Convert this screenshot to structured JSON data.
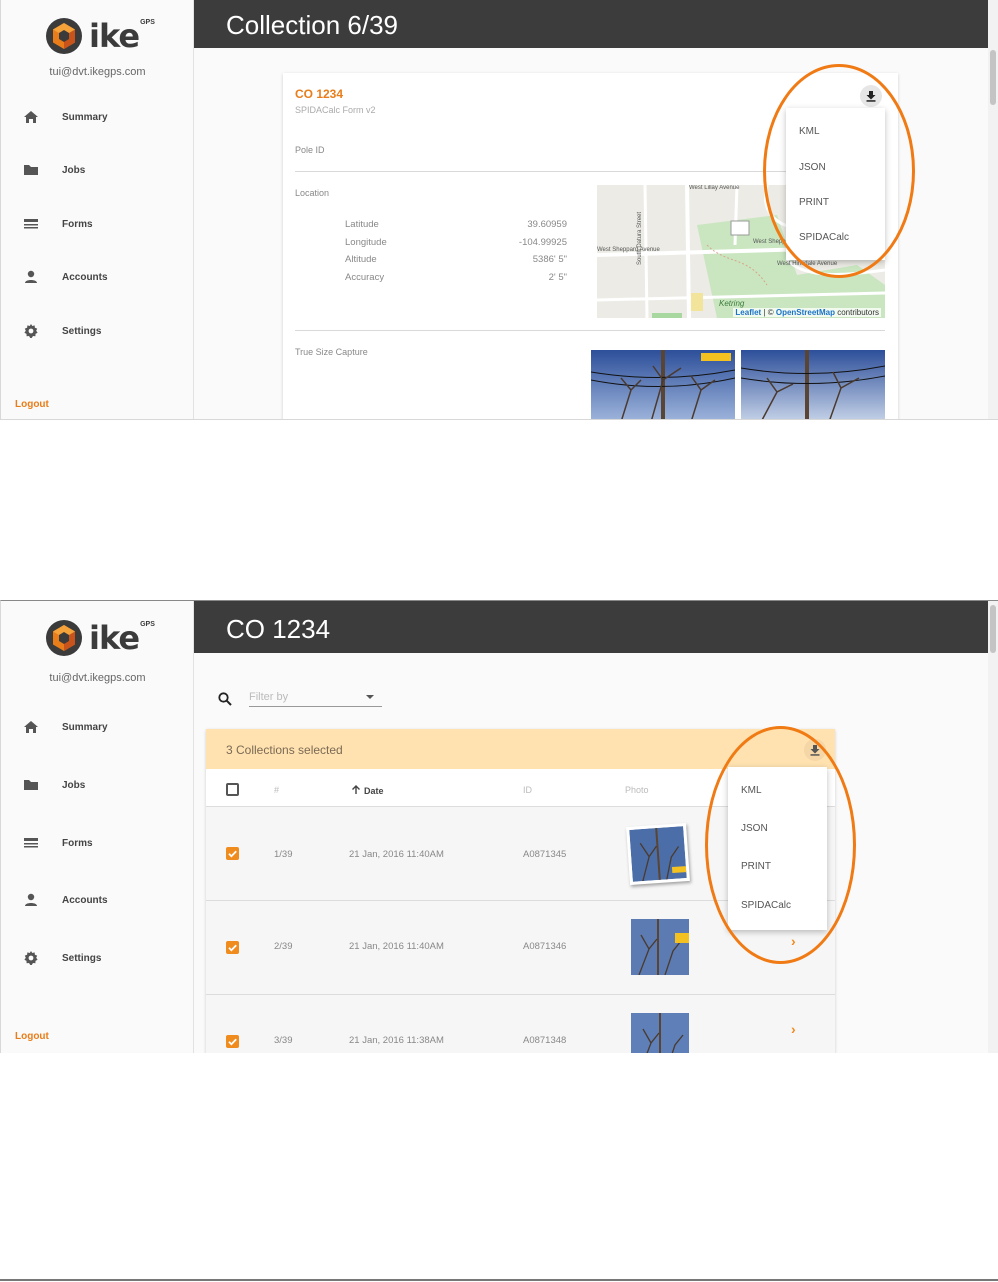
{
  "brand": {
    "name": "ike",
    "superscript": "GPS",
    "accent_color": "#e87d1a",
    "header_color": "#3c3c3c"
  },
  "sidebar": {
    "email": "tui@dvt.ikegps.com",
    "items": [
      {
        "label": "Summary",
        "icon": "home-icon"
      },
      {
        "label": "Jobs",
        "icon": "folder-icon"
      },
      {
        "label": "Forms",
        "icon": "forms-icon"
      },
      {
        "label": "Accounts",
        "icon": "person-icon"
      },
      {
        "label": "Settings",
        "icon": "gear-icon"
      }
    ],
    "logout_label": "Logout"
  },
  "download_menu": {
    "icon": "download-icon",
    "options": [
      "KML",
      "JSON",
      "PRINT",
      "SPIDACalc"
    ]
  },
  "collection_view": {
    "header_title": "Collection 6/39",
    "card_title": "CO 1234",
    "form_name": "SPIDACalc Form v2",
    "pole_id_label": "Pole ID",
    "location_label": "Location",
    "coordinates": [
      {
        "label": "Latitude",
        "value": "39.60959"
      },
      {
        "label": "Longitude",
        "value": "-104.99925"
      },
      {
        "label": "Altitude",
        "value": "5386' 5\""
      },
      {
        "label": "Accuracy",
        "value": "2' 5\""
      }
    ],
    "map": {
      "streets": [
        "West Lillay Avenue",
        "West Sheppard Avenue",
        "West Sheppard",
        "West Hinsdale Avenue",
        "South Datura Street",
        "Ketring"
      ],
      "attribution_leaflet": "Leaflet",
      "attribution_separator": " | © ",
      "attribution_osm": "OpenStreetMap",
      "attribution_suffix": " contributors"
    },
    "true_size_label": "True Size Capture"
  },
  "list_view": {
    "header_title": "CO 1234",
    "filter_placeholder": "Filter by",
    "selection_text": "3 Collections selected",
    "columns": {
      "number": "#",
      "date": "Date",
      "id": "ID",
      "photo": "Photo"
    },
    "rows": [
      {
        "number": "1/39",
        "date": "21 Jan, 2016 11:40AM",
        "id": "A0871345",
        "checked": true
      },
      {
        "number": "2/39",
        "date": "21 Jan, 2016 11:40AM",
        "id": "A0871346",
        "checked": true
      },
      {
        "number": "3/39",
        "date": "21 Jan, 2016 11:38AM",
        "id": "A0871348",
        "checked": true
      }
    ]
  }
}
